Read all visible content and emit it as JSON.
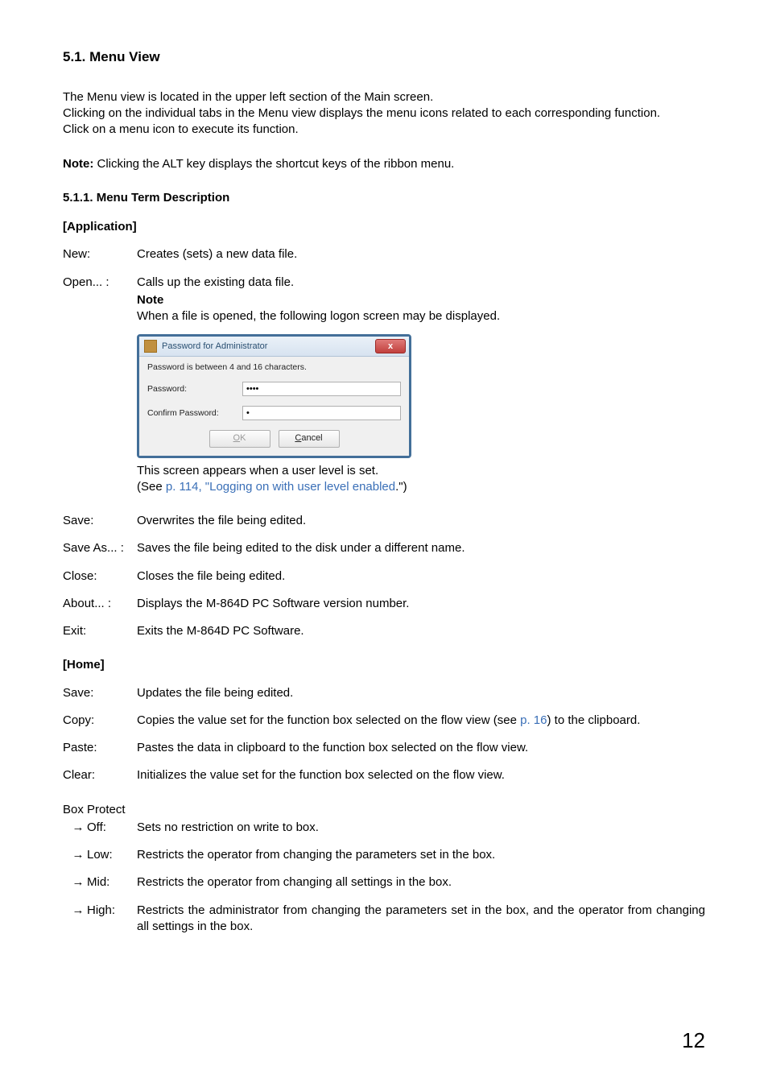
{
  "heading": "5.1. Menu View",
  "intro": [
    "The Menu view is located in the upper left section of the Main screen.",
    "Clicking on the individual tabs in the Menu view displays the menu icons related to each corresponding function.",
    "Click on a menu icon to execute its function."
  ],
  "note_label": "Note:",
  "note_text": " Clicking the ALT key displays the shortcut keys of the ribbon menu.",
  "sub_heading": "5.1.1. Menu Term Description",
  "app_group": "[Application]",
  "app": {
    "new_label": "New:",
    "new_desc": "Creates (sets) a new data file.",
    "open_label": "Open... :",
    "open_desc": "Calls up the existing data file.",
    "open_note_label": "Note",
    "open_note_text": "When a file is opened, the following logon screen may be displayed.",
    "after_dialog_1": "This screen appears when a user level is set.",
    "after_dialog_see_prefix": "(See ",
    "after_dialog_link": "p. 114, \"Logging on with user level enabled",
    "after_dialog_suffix": ".\")",
    "save_label": "Save:",
    "save_desc": "Overwrites the file being edited.",
    "saveas_label": "Save As... :",
    "saveas_desc": "Saves the file being edited to the disk under a different name.",
    "close_label": "Close:",
    "close_desc": "Closes the file being edited.",
    "about_label": "About... :",
    "about_desc": "Displays the M-864D PC Software version number.",
    "exit_label": "Exit:",
    "exit_desc": "Exits the M-864D PC Software."
  },
  "dialog": {
    "title": "Password for Administrator",
    "close_glyph": "x",
    "hint": "Password is between 4 and 16 characters.",
    "pw_label": "Password:",
    "pw_value": "aaaa",
    "confirm_label": "Confirm Password:",
    "confirm_value": "a",
    "ok_u": "O",
    "ok_rest": "K",
    "cancel_u": "C",
    "cancel_rest": "ancel"
  },
  "home_group": "[Home]",
  "home": {
    "save_label": "Save:",
    "save_desc": "Updates the file being edited.",
    "copy_label": "Copy:",
    "copy_desc_pre": "Copies the value set for the function box selected on the flow view (see ",
    "copy_link": "p. 16",
    "copy_desc_post": ") to the clipboard.",
    "paste_label": "Paste:",
    "paste_desc": "Pastes the data in clipboard to the function box selected on the flow view.",
    "clear_label": "Clear:",
    "clear_desc": "Initializes the value set for the function box selected on the flow view."
  },
  "box_protect_title": "Box Protect",
  "arrow": "→",
  "box": {
    "off_label": "Off:",
    "off_desc": "Sets no restriction on write to box.",
    "low_label": "Low:",
    "low_desc": "Restricts the operator from changing the parameters set in the box.",
    "mid_label": "Mid:",
    "mid_desc": "Restricts the operator from changing all settings in the box.",
    "high_label": "High:",
    "high_desc": "Restricts the administrator from changing the parameters set in the box, and the operator from changing all settings in the box."
  },
  "page_number": "12"
}
